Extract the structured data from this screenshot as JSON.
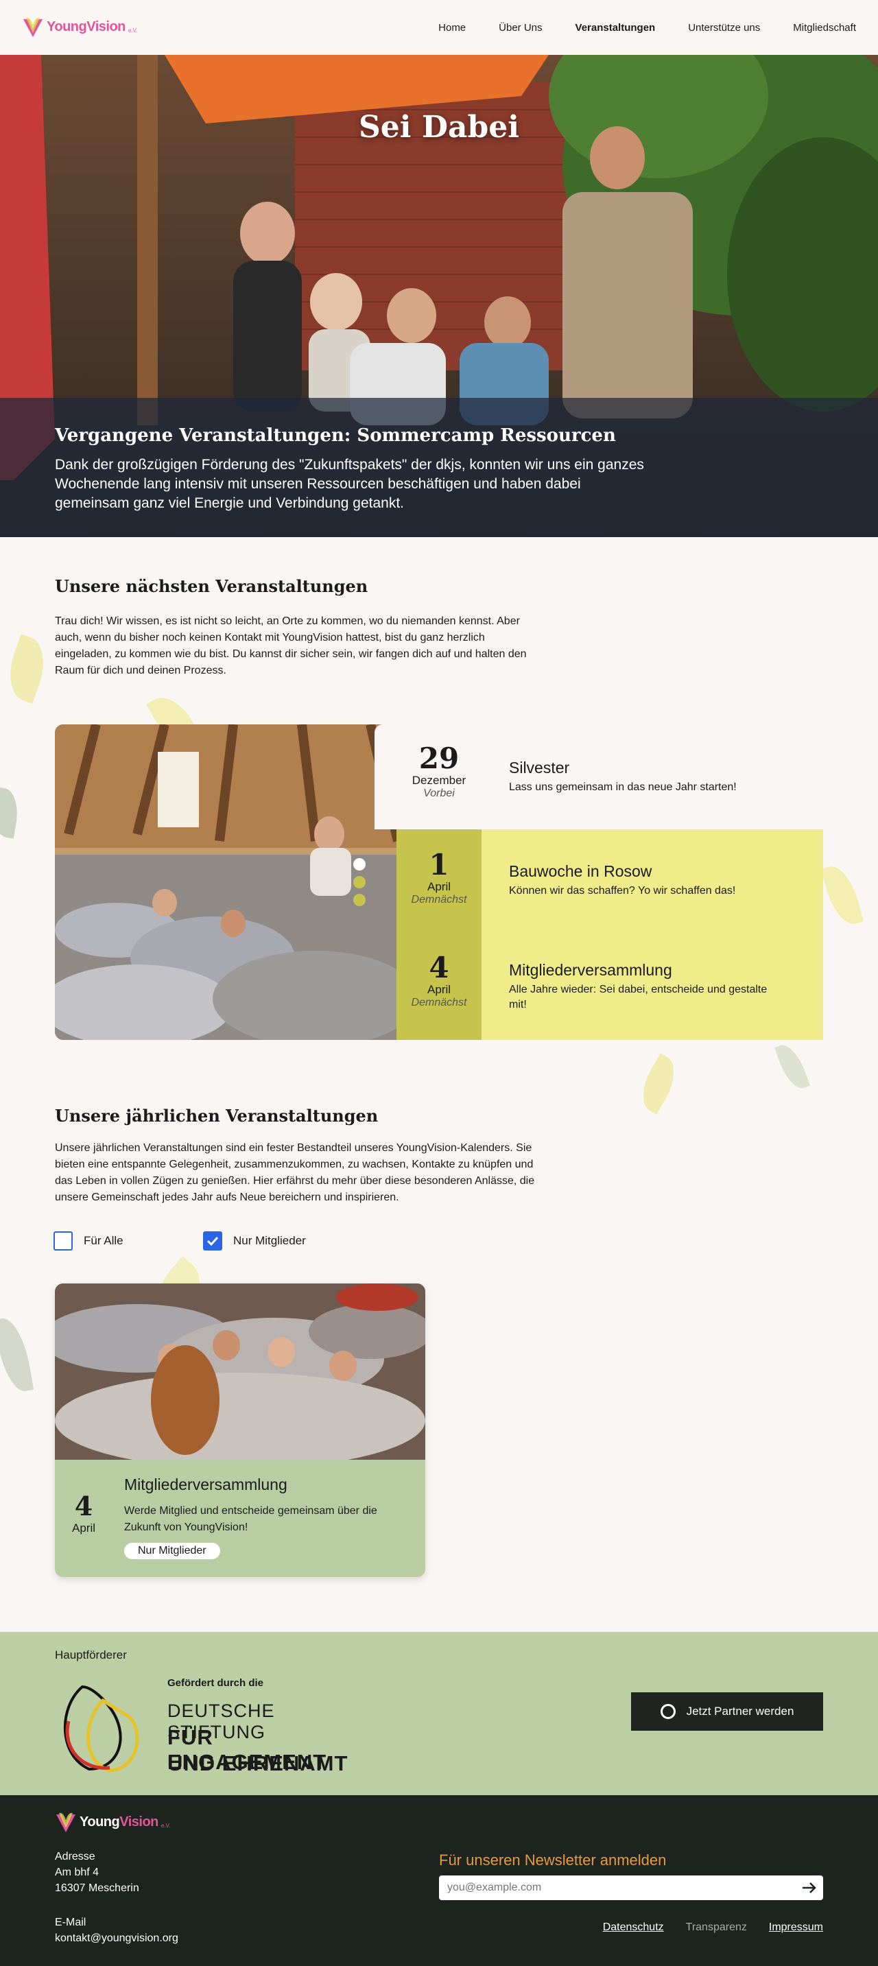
{
  "brand": {
    "name_part1": "Young",
    "name_part2": "Vision",
    "suffix": "e.V."
  },
  "nav": {
    "items": [
      "Home",
      "Über Uns",
      "Veranstaltungen",
      "Unterstütze uns",
      "Mitgliedschaft"
    ],
    "active": "Veranstaltungen"
  },
  "hero": {
    "title": "Sei Dabei",
    "subtitle": "Vergangene Veranstaltungen: Sommercamp Ressourcen",
    "text": "Dank der großzügigen Förderung des \"Zukunftspakets\" der dkjs, konnten wir uns ein ganzes Wochenende lang intensiv mit unseren Ressourcen beschäftigen und haben dabei gemeinsam ganz viel Energie und Verbindung getankt."
  },
  "upcoming": {
    "title": "Unsere nächsten Veranstaltungen",
    "text": "Trau dich! Wir wissen, es ist nicht so leicht, an Orte zu kommen, wo du niemanden kennst. Aber auch, wenn du bisher noch keinen Kontakt mit YoungVision hattest, bist du ganz herzlich eingeladen, zu kommen wie du bist. Du kannst dir sicher sein, wir fangen dich auf und halten den Raum für dich und deinen Prozess.",
    "events": [
      {
        "day": "29",
        "month": "Dezember",
        "status": "Vorbei",
        "title": "Silvester",
        "desc": "Lass uns gemeinsam in das neue Jahr starten!"
      },
      {
        "day": "1",
        "month": "April",
        "status": "Demnächst",
        "title": "Bauwoche in Rosow",
        "desc": "Können wir das schaffen? Yo wir schaffen das!"
      },
      {
        "day": "4",
        "month": "April",
        "status": "Demnächst",
        "title": "Mitgliederversammlung",
        "desc": "Alle Jahre wieder: Sei dabei, entscheide und gestalte mit!"
      }
    ]
  },
  "annual": {
    "title": "Unsere jährlichen Veranstaltungen",
    "text": "Unsere jährlichen Veranstaltungen sind ein fester Bestandteil unseres YoungVision-Kalenders. Sie bieten eine entspannte Gelegenheit, zusammenzukommen, zu wachsen, Kontakte zu knüpfen und das Leben in vollen Zügen zu genießen. Hier erfährst du mehr über diese besonderen Anlässe, die unsere Gemeinschaft jedes Jahr aufs Neue bereichern und inspirieren.",
    "filter_all": "Für Alle",
    "filter_members": "Nur Mitglieder",
    "card": {
      "day": "4",
      "month": "April",
      "title": "Mitgliederversammlung",
      "desc": "Werde Mitglied und entscheide gemeinsam über die Zukunft von YoungVision!",
      "badge": "Nur Mitglieder"
    }
  },
  "sponsor": {
    "label": "Hauptförderer",
    "small": "Gefördert durch die",
    "line1": "DEUTSCHE STIFTUNG",
    "line2": "FÜR ENGAGEMENT",
    "line3": "UND EHRENAMT",
    "button": "Jetzt Partner werden"
  },
  "footer": {
    "address_label": "Adresse",
    "address_1": "Am bhf 4",
    "address_2": "16307 Mescherin",
    "email_label": "E-Mail",
    "email": "kontakt@youngvision.org",
    "newsletter_title": "Für unseren Newsletter anmelden",
    "newsletter_placeholder": "you@example.com",
    "links": [
      "Datenschutz",
      "Transparenz",
      "Impressum"
    ]
  },
  "colors": {
    "accent_pink": "#e2559a",
    "yellow": "#f0ec8a",
    "olive": "#c7c44d",
    "green_band": "#bbcea4",
    "footer_bg": "#1d2420",
    "newsletter_orange": "#e59b3a",
    "check_blue": "#2b64e6"
  }
}
